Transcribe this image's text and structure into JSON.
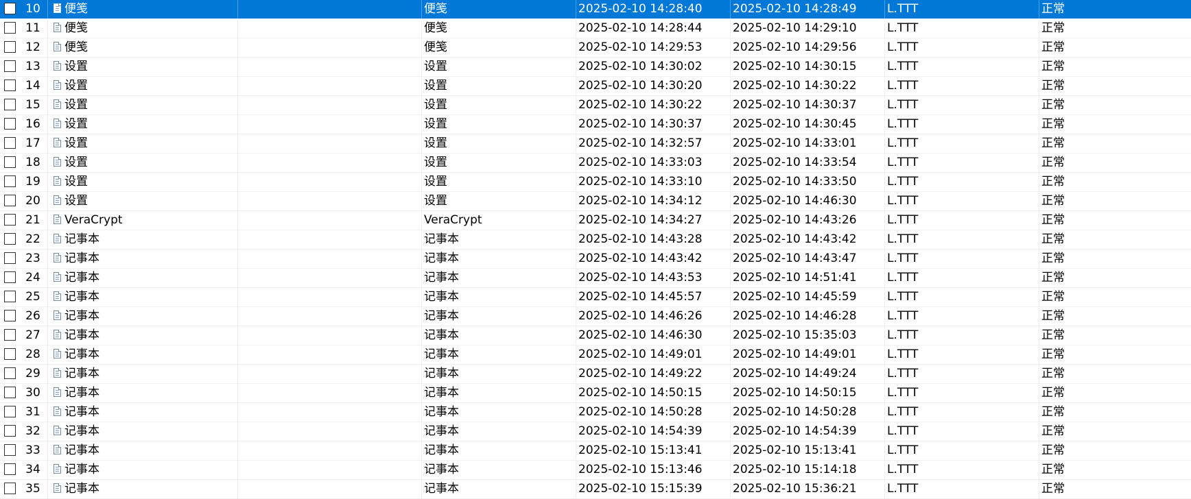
{
  "colors": {
    "selection_background": "#0078d7",
    "selection_text": "#ffffff",
    "gridline": "#f0f0f0"
  },
  "icons": {
    "row_icon": "document-icon",
    "checkbox": "checkbox-unchecked"
  },
  "selected_row_index": 0,
  "rows": [
    {
      "num": "10",
      "name": "便笺",
      "process": "便笺",
      "start": "2025-02-10 14:28:40",
      "end": "2025-02-10 14:28:49",
      "user": "L.TTT",
      "status": "正常"
    },
    {
      "num": "11",
      "name": "便笺",
      "process": "便笺",
      "start": "2025-02-10 14:28:44",
      "end": "2025-02-10 14:29:10",
      "user": "L.TTT",
      "status": "正常"
    },
    {
      "num": "12",
      "name": "便笺",
      "process": "便笺",
      "start": "2025-02-10 14:29:53",
      "end": "2025-02-10 14:29:56",
      "user": "L.TTT",
      "status": "正常"
    },
    {
      "num": "13",
      "name": "设置",
      "process": "设置",
      "start": "2025-02-10 14:30:02",
      "end": "2025-02-10 14:30:15",
      "user": "L.TTT",
      "status": "正常"
    },
    {
      "num": "14",
      "name": "设置",
      "process": "设置",
      "start": "2025-02-10 14:30:20",
      "end": "2025-02-10 14:30:22",
      "user": "L.TTT",
      "status": "正常"
    },
    {
      "num": "15",
      "name": "设置",
      "process": "设置",
      "start": "2025-02-10 14:30:22",
      "end": "2025-02-10 14:30:37",
      "user": "L.TTT",
      "status": "正常"
    },
    {
      "num": "16",
      "name": "设置",
      "process": "设置",
      "start": "2025-02-10 14:30:37",
      "end": "2025-02-10 14:30:45",
      "user": "L.TTT",
      "status": "正常"
    },
    {
      "num": "17",
      "name": "设置",
      "process": "设置",
      "start": "2025-02-10 14:32:57",
      "end": "2025-02-10 14:33:01",
      "user": "L.TTT",
      "status": "正常"
    },
    {
      "num": "18",
      "name": "设置",
      "process": "设置",
      "start": "2025-02-10 14:33:03",
      "end": "2025-02-10 14:33:54",
      "user": "L.TTT",
      "status": "正常"
    },
    {
      "num": "19",
      "name": "设置",
      "process": "设置",
      "start": "2025-02-10 14:33:10",
      "end": "2025-02-10 14:33:50",
      "user": "L.TTT",
      "status": "正常"
    },
    {
      "num": "20",
      "name": "设置",
      "process": "设置",
      "start": "2025-02-10 14:34:12",
      "end": "2025-02-10 14:46:30",
      "user": "L.TTT",
      "status": "正常"
    },
    {
      "num": "21",
      "name": "VeraCrypt",
      "process": "VeraCrypt",
      "start": "2025-02-10 14:34:27",
      "end": "2025-02-10 14:43:26",
      "user": "L.TTT",
      "status": "正常"
    },
    {
      "num": "22",
      "name": "记事本",
      "process": "记事本",
      "start": "2025-02-10 14:43:28",
      "end": "2025-02-10 14:43:42",
      "user": "L.TTT",
      "status": "正常"
    },
    {
      "num": "23",
      "name": "记事本",
      "process": "记事本",
      "start": "2025-02-10 14:43:42",
      "end": "2025-02-10 14:43:47",
      "user": "L.TTT",
      "status": "正常"
    },
    {
      "num": "24",
      "name": "记事本",
      "process": "记事本",
      "start": "2025-02-10 14:43:53",
      "end": "2025-02-10 14:51:41",
      "user": "L.TTT",
      "status": "正常"
    },
    {
      "num": "25",
      "name": "记事本",
      "process": "记事本",
      "start": "2025-02-10 14:45:57",
      "end": "2025-02-10 14:45:59",
      "user": "L.TTT",
      "status": "正常"
    },
    {
      "num": "26",
      "name": "记事本",
      "process": "记事本",
      "start": "2025-02-10 14:46:26",
      "end": "2025-02-10 14:46:28",
      "user": "L.TTT",
      "status": "正常"
    },
    {
      "num": "27",
      "name": "记事本",
      "process": "记事本",
      "start": "2025-02-10 14:46:30",
      "end": "2025-02-10 15:35:03",
      "user": "L.TTT",
      "status": "正常"
    },
    {
      "num": "28",
      "name": "记事本",
      "process": "记事本",
      "start": "2025-02-10 14:49:01",
      "end": "2025-02-10 14:49:01",
      "user": "L.TTT",
      "status": "正常"
    },
    {
      "num": "29",
      "name": "记事本",
      "process": "记事本",
      "start": "2025-02-10 14:49:22",
      "end": "2025-02-10 14:49:24",
      "user": "L.TTT",
      "status": "正常"
    },
    {
      "num": "30",
      "name": "记事本",
      "process": "记事本",
      "start": "2025-02-10 14:50:15",
      "end": "2025-02-10 14:50:15",
      "user": "L.TTT",
      "status": "正常"
    },
    {
      "num": "31",
      "name": "记事本",
      "process": "记事本",
      "start": "2025-02-10 14:50:28",
      "end": "2025-02-10 14:50:28",
      "user": "L.TTT",
      "status": "正常"
    },
    {
      "num": "32",
      "name": "记事本",
      "process": "记事本",
      "start": "2025-02-10 14:54:39",
      "end": "2025-02-10 14:54:39",
      "user": "L.TTT",
      "status": "正常"
    },
    {
      "num": "33",
      "name": "记事本",
      "process": "记事本",
      "start": "2025-02-10 15:13:41",
      "end": "2025-02-10 15:13:41",
      "user": "L.TTT",
      "status": "正常"
    },
    {
      "num": "34",
      "name": "记事本",
      "process": "记事本",
      "start": "2025-02-10 15:13:46",
      "end": "2025-02-10 15:14:18",
      "user": "L.TTT",
      "status": "正常"
    },
    {
      "num": "35",
      "name": "记事本",
      "process": "记事本",
      "start": "2025-02-10 15:15:39",
      "end": "2025-02-10 15:36:21",
      "user": "L.TTT",
      "status": "正常"
    }
  ]
}
